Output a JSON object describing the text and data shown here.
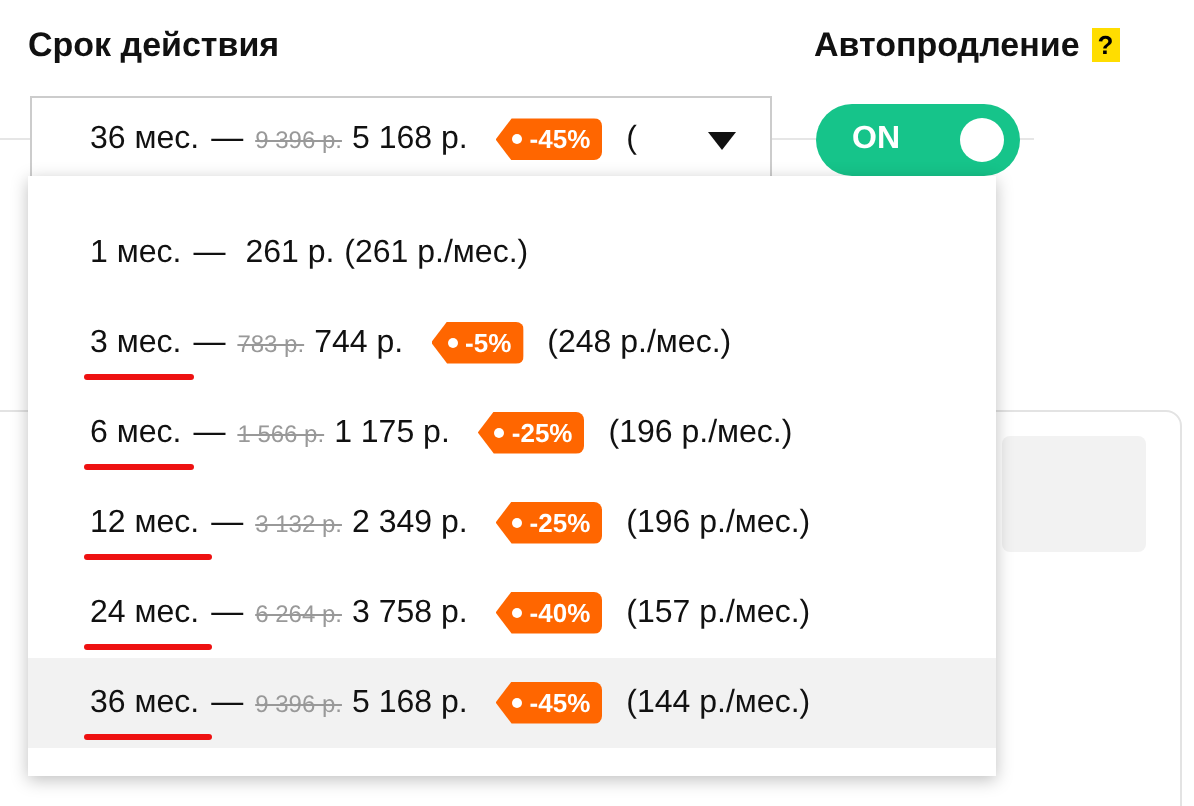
{
  "term": {
    "label": "Срок действия",
    "value": {
      "duration": "36 мес.",
      "separator": "—",
      "old_price": "9 396 р.",
      "price": "5 168 р.",
      "discount": "-45%",
      "per_month": "("
    },
    "expanded": true,
    "options": [
      {
        "duration": "1 мес.",
        "separator": "—",
        "price": "261 р.",
        "per_month": "(261 р./мес.)",
        "selected": false,
        "annotated": false
      },
      {
        "duration": "3 мес.",
        "separator": "—",
        "old_price": "783 р.",
        "price": "744 р.",
        "discount": "-5%",
        "per_month": "(248 р./мес.)",
        "selected": false,
        "annotated": true
      },
      {
        "duration": "6 мес.",
        "separator": "—",
        "old_price": "1 566 р.",
        "price": "1 175 р.",
        "discount": "-25%",
        "per_month": "(196 р./мес.)",
        "selected": false,
        "annotated": true
      },
      {
        "duration": "12 мес.",
        "separator": "—",
        "old_price": "3 132 р.",
        "price": "2 349 р.",
        "discount": "-25%",
        "per_month": "(196 р./мес.)",
        "selected": false,
        "annotated": true
      },
      {
        "duration": "24 мес.",
        "separator": "—",
        "old_price": "6 264 р.",
        "price": "3 758 р.",
        "discount": "-40%",
        "per_month": "(157 р./мес.)",
        "selected": false,
        "annotated": true
      },
      {
        "duration": "36 мес.",
        "separator": "—",
        "old_price": "9 396 р.",
        "price": "5 168 р.",
        "discount": "-45%",
        "per_month": "(144 р./мес.)",
        "selected": true,
        "annotated": true
      }
    ]
  },
  "autorenew": {
    "label": "Автопродление",
    "help": "?",
    "toggle": {
      "label": "ON",
      "on": true
    }
  }
}
